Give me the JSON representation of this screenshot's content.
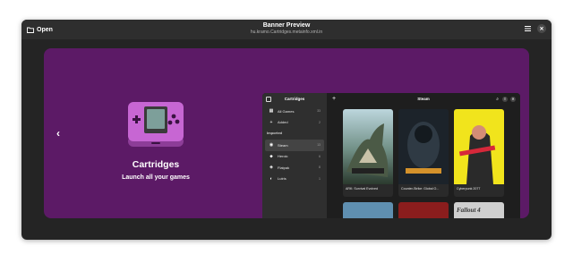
{
  "header": {
    "open_label": "Open",
    "title": "Banner Preview",
    "subtitle": "hu.kramo.Cartridges.metainfo.xml.in"
  },
  "banner": {
    "background_color": "#5c1a66",
    "app_name": "Cartridges",
    "tagline": "Launch all your games",
    "prev_icon": "chevron-left-icon",
    "next_icon": "chevron-right-icon"
  },
  "preview": {
    "sidebar": {
      "title": "Cartridges",
      "items": [
        {
          "label": "All Games",
          "count": "33",
          "icon": "grid-icon"
        },
        {
          "label": "Added",
          "count": "2",
          "icon": "plus-icon"
        }
      ],
      "section_label": "Imported",
      "sources": [
        {
          "label": "Steam",
          "count": "13",
          "icon": "steam-icon",
          "active": true
        },
        {
          "label": "Heroic",
          "count": "6",
          "icon": "heroic-icon"
        },
        {
          "label": "Flatpak",
          "count": "8",
          "icon": "flatpak-icon"
        },
        {
          "label": "Lutris",
          "count": "1",
          "icon": "lutris-icon"
        }
      ]
    },
    "content": {
      "title": "Steam",
      "games": [
        {
          "title": "ARK: Survival Evolved"
        },
        {
          "title": "Counter-Strike: Global O..."
        },
        {
          "title": "Cyberpunk 2077"
        }
      ],
      "row2_cover_text": "Fallout 4"
    }
  }
}
